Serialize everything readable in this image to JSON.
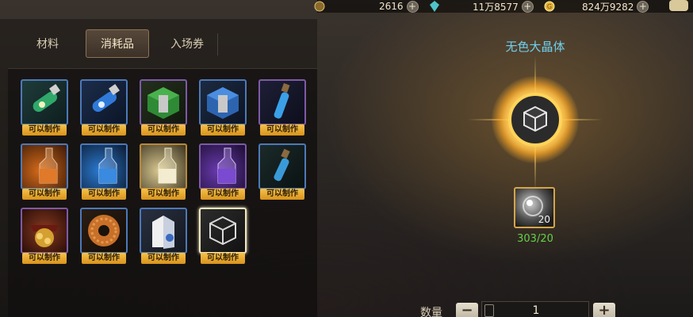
{
  "resources": [
    {
      "name": "coin",
      "icon": "moon-coin-icon",
      "value": "2616",
      "color": "#d6b46a"
    },
    {
      "name": "gem",
      "icon": "crystal-icon",
      "value": "11万8577",
      "color": "#4fc3c7"
    },
    {
      "name": "gold",
      "icon": "gold-coin-icon",
      "value": "824万9282",
      "color": "#e4b43a"
    }
  ],
  "tabs": [
    {
      "label": "材料",
      "active": false
    },
    {
      "label": "消耗品",
      "active": true
    },
    {
      "label": "入场券",
      "active": false
    }
  ],
  "items": [
    {
      "name": "green-moon-potion",
      "status": "可以制作",
      "rarity": "blue",
      "icon": "green-vial-icon"
    },
    {
      "name": "blue-moon-potion",
      "status": "可以制作",
      "rarity": "blue",
      "icon": "blue-vial-icon"
    },
    {
      "name": "green-box",
      "status": "可以制作",
      "rarity": "purple",
      "icon": "green-box-icon"
    },
    {
      "name": "blue-box",
      "status": "可以制作",
      "rarity": "blue",
      "icon": "blue-box-icon"
    },
    {
      "name": "blue-elixir",
      "status": "可以制作",
      "rarity": "purple",
      "icon": "blue-elixir-icon"
    },
    {
      "name": "fire-potion",
      "status": "可以制作",
      "rarity": "blue",
      "icon": "orange-bottle-icon"
    },
    {
      "name": "water-potion",
      "status": "可以制作",
      "rarity": "blue",
      "icon": "blue-bottle-icon"
    },
    {
      "name": "light-potion",
      "status": "可以制作",
      "rarity": "blue",
      "icon": "white-bottle-icon"
    },
    {
      "name": "shadow-potion",
      "status": "可以制作",
      "rarity": "purple",
      "icon": "purple-bottle-icon"
    },
    {
      "name": "small-blue-vial",
      "status": "可以制作",
      "rarity": "blue",
      "icon": "small-vial-icon"
    },
    {
      "name": "pirate-treasure",
      "status": "可以制作",
      "rarity": "purple",
      "icon": "treasure-icon"
    },
    {
      "name": "donut",
      "status": "可以制作",
      "rarity": "blue",
      "icon": "donut-icon"
    },
    {
      "name": "milk-carton",
      "status": "可以制作",
      "rarity": "blue",
      "icon": "milk-carton-icon"
    },
    {
      "name": "colorless-crystal",
      "status": "可以制作",
      "rarity": "selected",
      "icon": "cube-icon"
    }
  ],
  "selected_item": {
    "title": "无色大晶体",
    "icon": "cube-icon",
    "material": {
      "icon": "orb-icon",
      "count": "20",
      "progress": "303/20"
    }
  },
  "quantity": {
    "label": "数量",
    "minus": "−",
    "plus": "+",
    "value": "1"
  }
}
